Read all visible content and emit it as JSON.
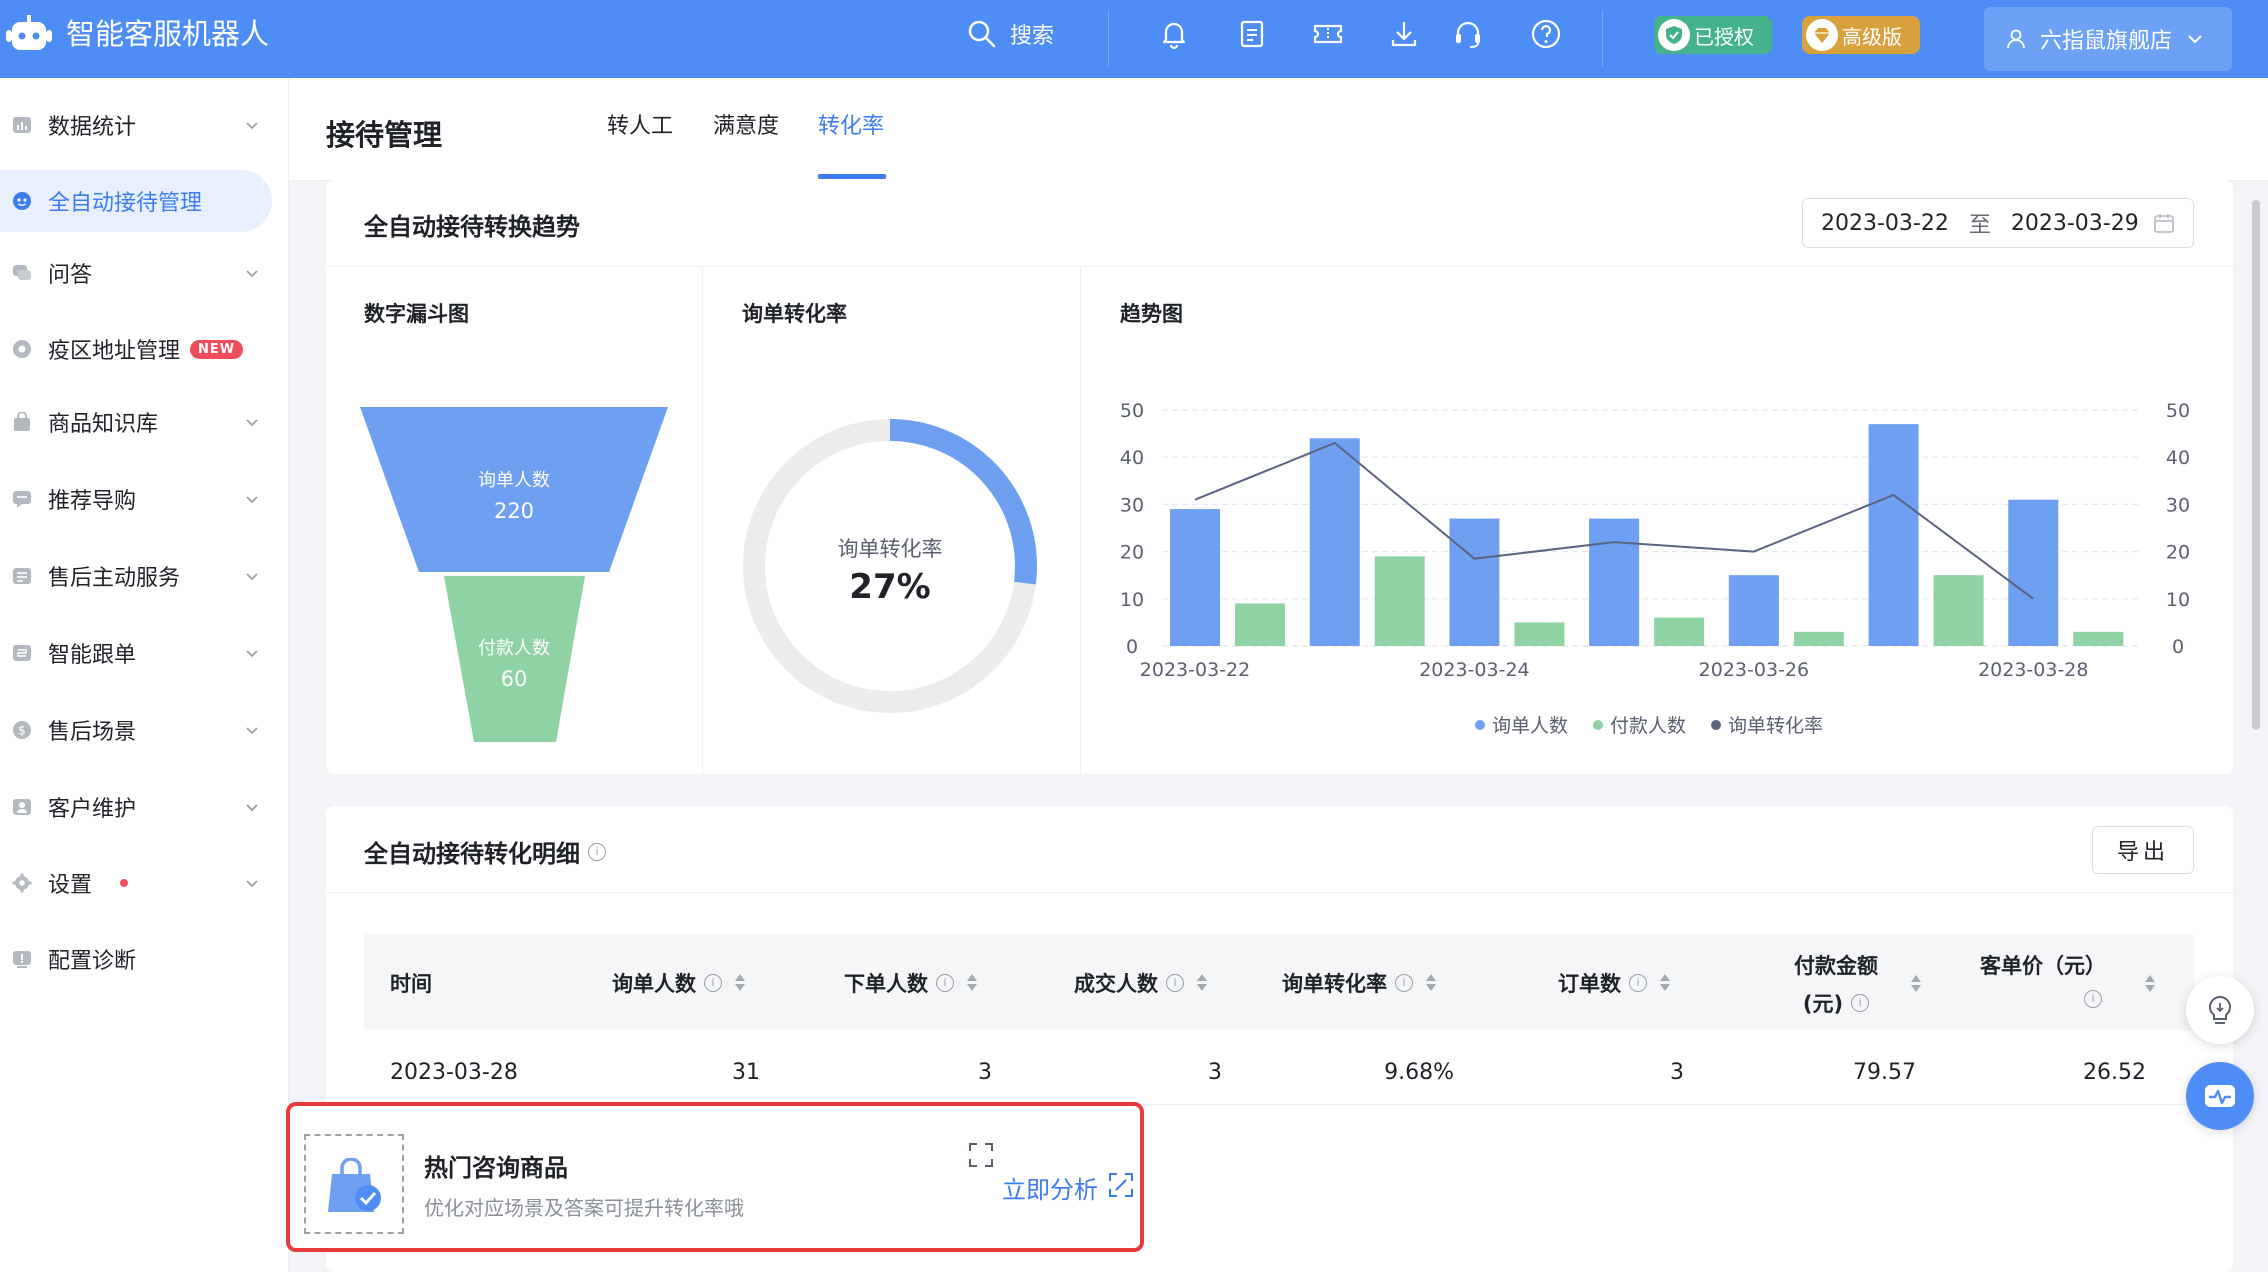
{
  "header": {
    "app_title": "智能客服机器人",
    "search_label": "搜索",
    "auth_badge": "已授权",
    "pro_badge": "高级版",
    "user_name": "六指鼠旗舰店",
    "accent": "#4e8df5"
  },
  "sidebar": {
    "items": [
      {
        "label": "数据统计",
        "icon": "bar-chart-icon",
        "has_chevron": true
      },
      {
        "label": "全自动接待管理",
        "icon": "robot-face-icon",
        "active": true
      },
      {
        "label": "问答",
        "icon": "chat-icon",
        "has_chevron": true
      },
      {
        "label": "疫区地址管理",
        "icon": "location-icon",
        "tag": "NEW"
      },
      {
        "label": "商品知识库",
        "icon": "bag-icon",
        "has_chevron": true
      },
      {
        "label": "推荐导购",
        "icon": "message-icon",
        "has_chevron": true
      },
      {
        "label": "售后主动服务",
        "icon": "list-icon",
        "has_chevron": true
      },
      {
        "label": "智能跟单",
        "icon": "follow-icon",
        "has_chevron": true
      },
      {
        "label": "售后场景",
        "icon": "dollar-icon",
        "has_chevron": true
      },
      {
        "label": "客户维护",
        "icon": "contact-icon",
        "has_chevron": true
      },
      {
        "label": "设置",
        "icon": "gear-icon",
        "has_chevron": true,
        "dot": true
      },
      {
        "label": "配置诊断",
        "icon": "alert-icon"
      }
    ]
  },
  "page": {
    "title": "接待管理",
    "tabs": [
      "转人工",
      "满意度",
      "转化率"
    ],
    "active_tab": "转化率"
  },
  "trend_card": {
    "title": "全自动接待转换趋势",
    "date_start": "2023-03-22",
    "date_sep": "至",
    "date_end": "2023-03-29",
    "funnel": {
      "title": "数字漏斗图",
      "top_label": "询单人数",
      "top_value": "220",
      "bottom_label": "付款人数",
      "bottom_value": "60",
      "top_color": "#6e9ff0",
      "bottom_color": "#8fd3a4"
    },
    "donut": {
      "title": "询单转化率",
      "center_label": "询单转化率",
      "center_value": "27%",
      "fraction": 0.27,
      "color": "#6e9ff0",
      "track_color": "#ececec"
    }
  },
  "chart_data": {
    "type": "bar",
    "title": "趋势图",
    "x": [
      "2023-03-22",
      "2023-03-23",
      "2023-03-24",
      "2023-03-25",
      "2023-03-26",
      "2023-03-27",
      "2023-03-28"
    ],
    "x_tick_labels": [
      "2023-03-22",
      "2023-03-24",
      "2023-03-26",
      "2023-03-28"
    ],
    "ylim": [
      0,
      50
    ],
    "y_ticks": [
      0,
      10,
      20,
      30,
      40,
      50
    ],
    "y2lim": [
      0,
      50
    ],
    "grid": true,
    "legend_position": "bottom",
    "series": [
      {
        "name": "询单人数",
        "type": "bar",
        "color": "#6e9ff0",
        "values": [
          29,
          44,
          27,
          27,
          15,
          47,
          31
        ]
      },
      {
        "name": "付款人数",
        "type": "bar",
        "color": "#8fd3a4",
        "values": [
          9,
          19,
          5,
          6,
          3,
          15,
          3
        ]
      },
      {
        "name": "询单转化率",
        "type": "line",
        "color": "#5a6480",
        "values": [
          31,
          43,
          18.5,
          22,
          20,
          32,
          10
        ]
      }
    ]
  },
  "detail_card": {
    "title": "全自动接待转化明细",
    "export_label": "导出",
    "columns": [
      {
        "label": "时间"
      },
      {
        "label": "询单人数"
      },
      {
        "label": "下单人数"
      },
      {
        "label": "成交人数"
      },
      {
        "label": "询单转化率"
      },
      {
        "label": "订单数"
      },
      {
        "label": "付款金额",
        "label2": "(元)"
      },
      {
        "label": "客单价（元）"
      }
    ],
    "rows": [
      [
        "2023-03-28",
        "31",
        "3",
        "3",
        "9.68%",
        "3",
        "79.57",
        "26.52"
      ]
    ]
  },
  "popup": {
    "title": "热门咨询商品",
    "desc": "优化对应场景及答案可提升转化率哦",
    "link": "立即分析",
    "highlight_color": "#e8393b"
  }
}
